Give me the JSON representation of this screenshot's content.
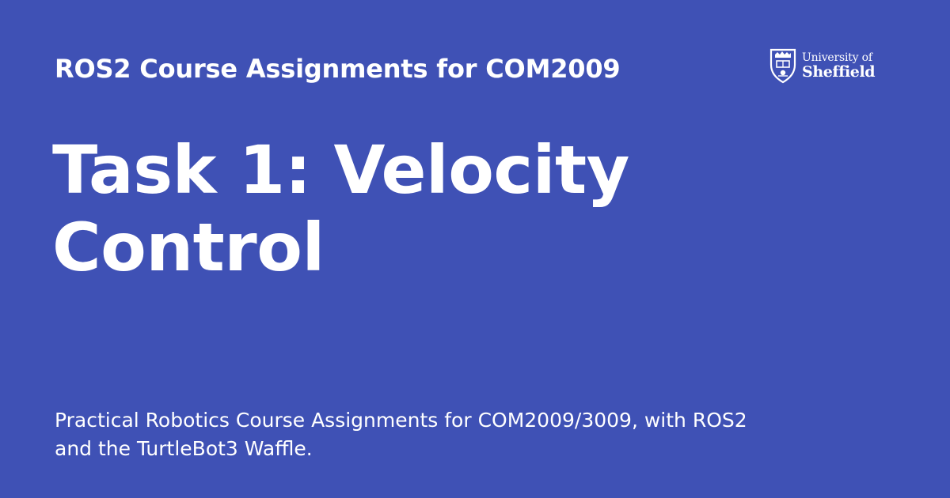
{
  "site": {
    "name": "ROS2 Course Assignments for COM2009"
  },
  "page": {
    "title": "Task 1: Velocity Control",
    "description": "Practical Robotics Course Assignments for COM2009/3009, with ROS2 and the TurtleBot3 Waffle."
  },
  "logo": {
    "icon": "university-crest-icon",
    "line1": "University of",
    "line2": "Sheffield"
  },
  "colors": {
    "background": "#3f51b5",
    "text": "#ffffff"
  }
}
